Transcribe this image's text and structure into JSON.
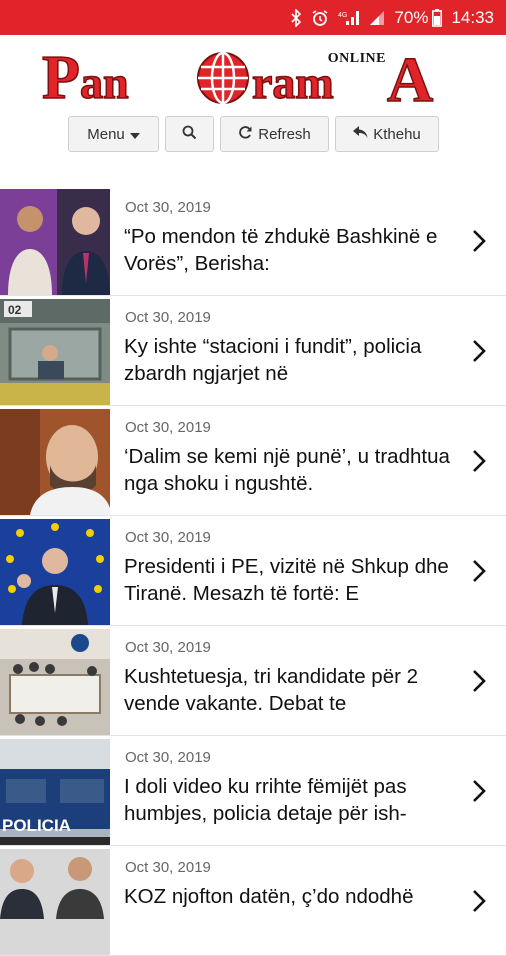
{
  "status_bar": {
    "battery": "70%",
    "time": "14:33",
    "color": "#e0242a"
  },
  "logo": {
    "brand": "PanoramA",
    "online_label": "ONLINE",
    "color": "#e0242a"
  },
  "toolbar": {
    "menu_label": "Menu",
    "refresh_label": "Refresh",
    "back_label": "Kthehu"
  },
  "articles": [
    {
      "date": "Oct 30, 2019",
      "title": "“Po mendon të zhdukë Bashkinë e Vorës”, Berisha:"
    },
    {
      "date": "Oct 30, 2019",
      "title": "Ky ishte “stacioni i fundit”, policia zbardh ngjarjet në"
    },
    {
      "date": "Oct 30, 2019",
      "title": "‘Dalim se kemi një punë’, u tradhtua nga shoku i ngushtë."
    },
    {
      "date": "Oct 30, 2019",
      "title": "Presidenti i PE, vizitë në Shkup dhe Tiranë. Mesazh të fortë: E"
    },
    {
      "date": "Oct 30, 2019",
      "title": "Kushtetuesja, tri kandidate për 2 vende vakante. Debat te"
    },
    {
      "date": "Oct 30, 2019",
      "title": "I doli video ku rrihte fëmijët pas humbjes, policia detaje për ish-"
    },
    {
      "date": "Oct 30, 2019",
      "title": "KOZ njofton datën, ç’do ndodhë"
    }
  ]
}
